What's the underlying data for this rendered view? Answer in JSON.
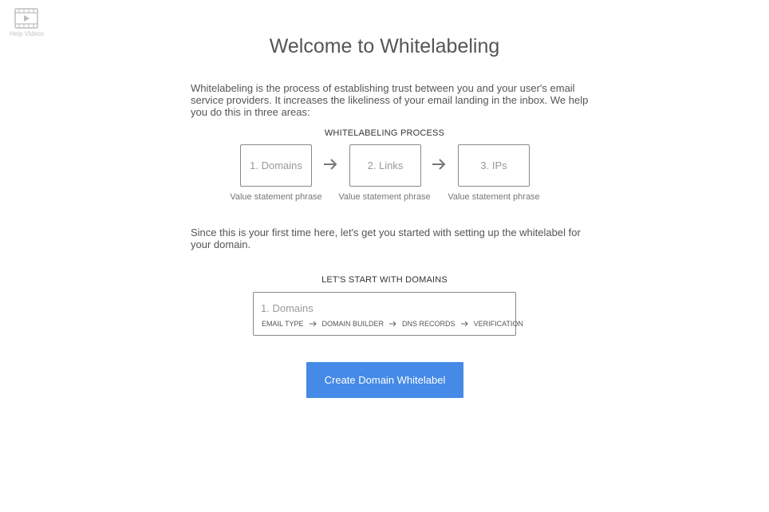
{
  "help": {
    "label": "Help Videos",
    "icon": "film-play-icon"
  },
  "title": "Welcome to Whitelabeling",
  "intro": "Whitelabeling is the process of establishing trust between you and your user's email service providers. It increases the likeliness of your email landing in the inbox. We help you do this in three areas:",
  "process": {
    "heading": "WHITELABELING PROCESS",
    "steps": [
      {
        "label": "1. Domains",
        "value": "Value statement phrase"
      },
      {
        "label": "2. Links",
        "value": "Value statement phrase"
      },
      {
        "label": "3. IPs",
        "value": "Value statement phrase"
      }
    ],
    "arrow_icon": "arrow-right-icon"
  },
  "since": "Since this is your first time here, let's get you started with setting up the whitelabel for your domain.",
  "start": {
    "heading": "LET'S START WITH DOMAINS",
    "card_title": "1. Domains",
    "substeps": [
      "EMAIL TYPE",
      "DOMAIN BUILDER",
      "DNS RECORDS",
      "VERIFICATION"
    ]
  },
  "cta": {
    "label": "Create Domain Whitelabel",
    "color": "#448ae6"
  }
}
